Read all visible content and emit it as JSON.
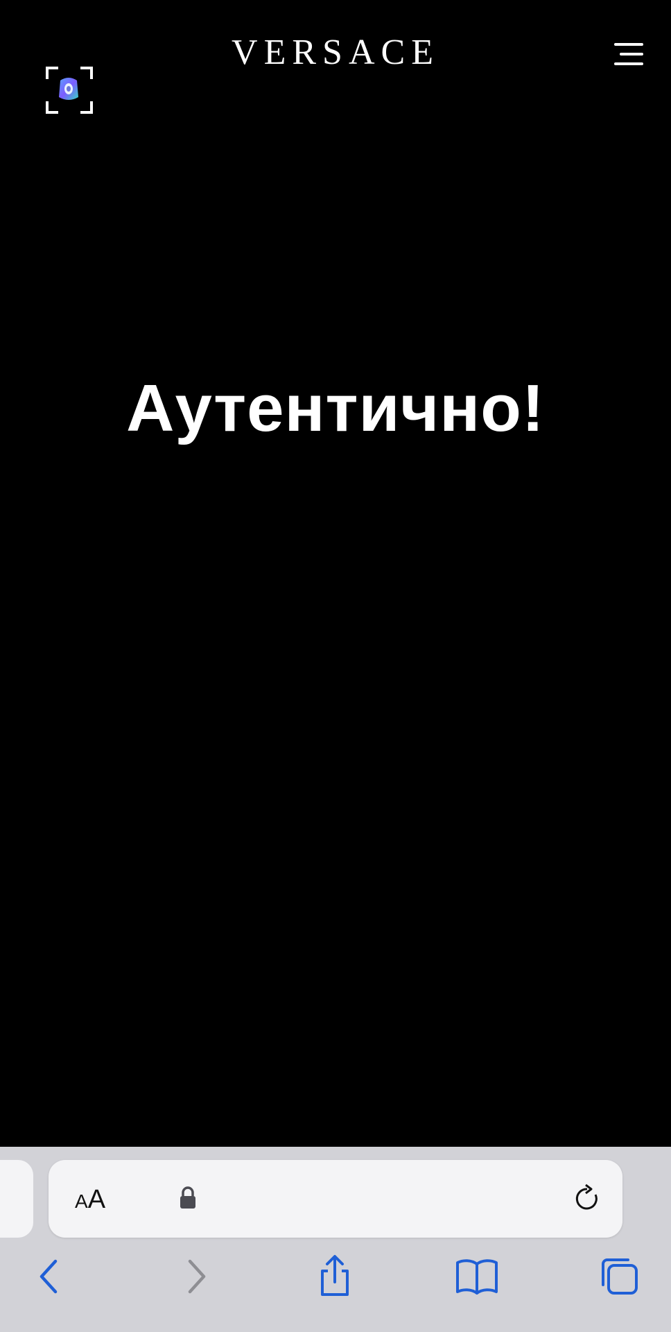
{
  "header": {
    "brand": "VERSACE",
    "scan_icon": "scan-viewfinder-icon",
    "menu_icon": "hamburger-menu-icon"
  },
  "main": {
    "headline": "Аутентично!"
  },
  "browser": {
    "address_bar": {
      "text_size_label": "AA",
      "lock_icon": "lock-icon",
      "reload_icon": "reload-icon"
    },
    "toolbar": {
      "back_icon": "chevron-left-icon",
      "forward_icon": "chevron-right-icon",
      "share_icon": "share-icon",
      "bookmarks_icon": "book-icon",
      "tabs_icon": "tabs-icon"
    }
  },
  "colors": {
    "page_background": "#000000",
    "text": "#ffffff",
    "chrome_background": "#d2d2d7",
    "toolbar_accent": "#1f5fd6",
    "toolbar_disabled": "#8e8e93"
  }
}
